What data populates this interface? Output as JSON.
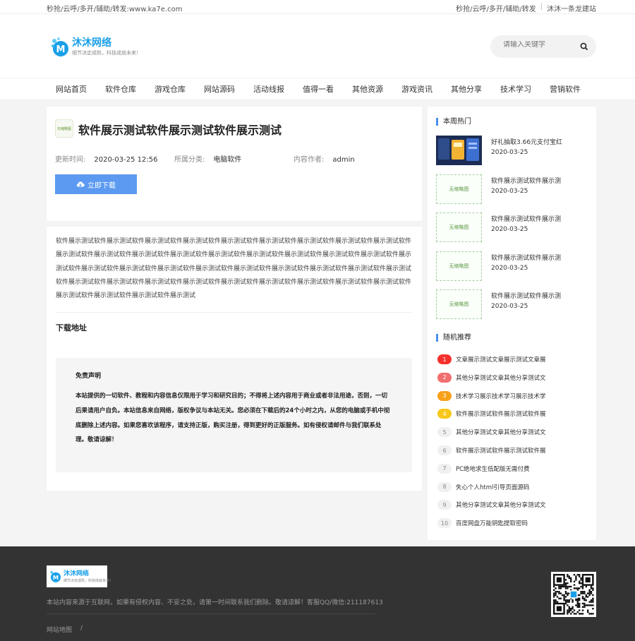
{
  "topbar": {
    "left_text": "秒抢/云呼/多开/辅助/转发:www.ka7e.com",
    "right_links": [
      "秒抢/云呼/多开/辅助/转发",
      "沐沐一条龙建站"
    ]
  },
  "brand": {
    "name": "沐沐网络",
    "slogan": "细节决定成败，科技成就未来！"
  },
  "search": {
    "placeholder": "请输入关键字"
  },
  "nav": [
    "网站首页",
    "软件仓库",
    "游戏仓库",
    "网站源码",
    "活动线报",
    "值得一看",
    "其他资源",
    "游戏资讯",
    "其他分享",
    "技术学习",
    "营销软件"
  ],
  "article": {
    "badge": "无缩略图",
    "title": "软件展示测试软件展示测试软件展示测试",
    "meta": [
      {
        "label": "更新时间:",
        "value": "2020-03-25 12:56"
      },
      {
        "label": "所属分类:",
        "value": "电脑软件"
      },
      {
        "label": "内容作者:",
        "value": "admin"
      }
    ],
    "download_label": "立即下载",
    "body": "软件展示测试软件展示测试软件展示测试软件展示测试软件展示测试软件展示测试软件展示测试软件展示测试软件展示测试软件展示测试软件展示测试软件展示测试软件展示测试软件展示测试软件展示测试软件展示测试软件展示测试软件展示测试软件展示测试软件展示测试软件展示测试软件展示测试软件展示测试软件展示测试软件展示测试软件展示测试软件展示测试软件展示测试软件展示测试软件展示测试软件展示测试软件展示测试软件展示测试软件展示测试软件展示测试软件展示测试软件展示测试软件展示测试软件展示测试软件展示测试软件展示测试",
    "download_section": "下载地址",
    "disclaimer_title": "免责声明",
    "disclaimer_text": "本站提供的一切软件、教程和内容信息仅限用于学习和研究目的；不得将上述内容用于商业或者非法用途，否则，一切后果请用户自负。本站信息来自网络，版权争议与本站无关。您必须在下载后的24个小时之内，从您的电脑或手机中彻底删除上述内容。如果您喜欢该程序，请支持正版，购买注册，得到更好的正版服务。如有侵权请邮件与我们联系处理。敬请谅解！"
  },
  "sidebar": {
    "hot_title": "本周热门",
    "no_thumb": "无缩略图",
    "hot": [
      {
        "title": "好礼抽取3.66元支付宝红",
        "date": "2020-03-25",
        "has_image": true
      },
      {
        "title": "软件展示测试软件展示测",
        "date": "2020-03-25",
        "has_image": false
      },
      {
        "title": "软件展示测试软件展示测",
        "date": "2020-03-25",
        "has_image": false
      },
      {
        "title": "软件展示测试软件展示测",
        "date": "2020-03-25",
        "has_image": false
      },
      {
        "title": "软件展示测试软件展示测",
        "date": "2020-03-25",
        "has_image": false
      }
    ],
    "random_title": "随机推荐",
    "random": [
      {
        "n": "1",
        "title": "文章展示测试文章展示测试文章展",
        "color": "#f5312c"
      },
      {
        "n": "2",
        "title": "其他分享测试文章其他分享测试文",
        "color": "#f26f6f"
      },
      {
        "n": "3",
        "title": "技术学习展示技术学习展示技术学",
        "color": "#f7a11b"
      },
      {
        "n": "4",
        "title": "软件展示测试软件展示测试软件展",
        "color": "#f7c81b"
      },
      {
        "n": "5",
        "title": "其他分享测试文章其他分享测试文",
        "color": ""
      },
      {
        "n": "6",
        "title": "软件展示测试软件展示测试软件展",
        "color": ""
      },
      {
        "n": "7",
        "title": "PC绝地求生低配版无需付费",
        "color": ""
      },
      {
        "n": "8",
        "title": "失心个人html引导页面源码",
        "color": ""
      },
      {
        "n": "9",
        "title": "其他分享测试文章其他分享测试文",
        "color": ""
      },
      {
        "n": "10",
        "title": "百度网盘万能钥匙提取密码",
        "color": ""
      }
    ]
  },
  "footer": {
    "note": "本站内容来源于互联网，如果有侵权内容、不妥之处，请第一时间联系我们删除。敬请谅解！客服QQ/微信:211187613",
    "links": [
      "网站地图",
      "/"
    ]
  },
  "colors": {
    "accent": "#5b9af0",
    "footer_bg": "#333333"
  }
}
